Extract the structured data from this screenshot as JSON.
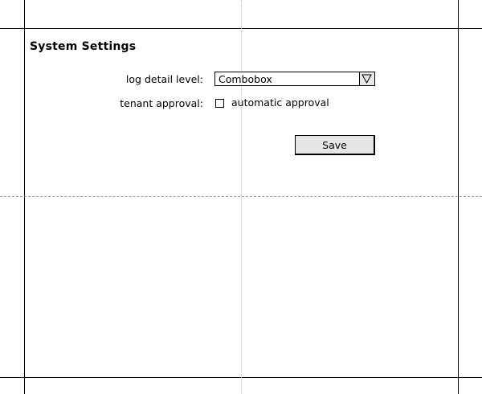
{
  "page": {
    "title": "System Settings"
  },
  "form": {
    "log_detail_level": {
      "label": "log detail level:",
      "value": "Combobox",
      "icon": "chevron-down-icon"
    },
    "tenant_approval": {
      "label": "tenant approval:",
      "checkbox_label": "automatic approval",
      "checked": false
    },
    "save_label": "Save"
  }
}
